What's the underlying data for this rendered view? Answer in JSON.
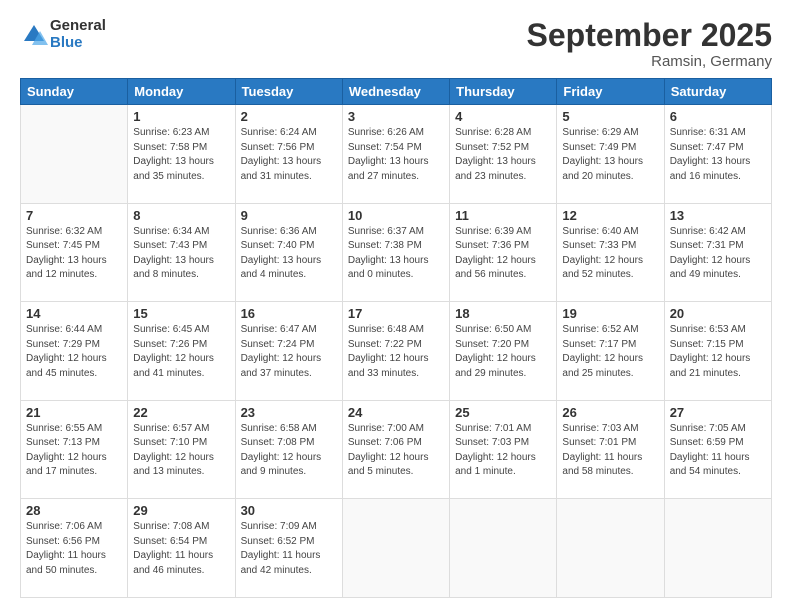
{
  "header": {
    "logo_line1": "General",
    "logo_line2": "Blue",
    "title": "September 2025",
    "subtitle": "Ramsin, Germany"
  },
  "days_of_week": [
    "Sunday",
    "Monday",
    "Tuesday",
    "Wednesday",
    "Thursday",
    "Friday",
    "Saturday"
  ],
  "weeks": [
    [
      {
        "day": "",
        "info": ""
      },
      {
        "day": "1",
        "info": "Sunrise: 6:23 AM\nSunset: 7:58 PM\nDaylight: 13 hours\nand 35 minutes."
      },
      {
        "day": "2",
        "info": "Sunrise: 6:24 AM\nSunset: 7:56 PM\nDaylight: 13 hours\nand 31 minutes."
      },
      {
        "day": "3",
        "info": "Sunrise: 6:26 AM\nSunset: 7:54 PM\nDaylight: 13 hours\nand 27 minutes."
      },
      {
        "day": "4",
        "info": "Sunrise: 6:28 AM\nSunset: 7:52 PM\nDaylight: 13 hours\nand 23 minutes."
      },
      {
        "day": "5",
        "info": "Sunrise: 6:29 AM\nSunset: 7:49 PM\nDaylight: 13 hours\nand 20 minutes."
      },
      {
        "day": "6",
        "info": "Sunrise: 6:31 AM\nSunset: 7:47 PM\nDaylight: 13 hours\nand 16 minutes."
      }
    ],
    [
      {
        "day": "7",
        "info": "Sunrise: 6:32 AM\nSunset: 7:45 PM\nDaylight: 13 hours\nand 12 minutes."
      },
      {
        "day": "8",
        "info": "Sunrise: 6:34 AM\nSunset: 7:43 PM\nDaylight: 13 hours\nand 8 minutes."
      },
      {
        "day": "9",
        "info": "Sunrise: 6:36 AM\nSunset: 7:40 PM\nDaylight: 13 hours\nand 4 minutes."
      },
      {
        "day": "10",
        "info": "Sunrise: 6:37 AM\nSunset: 7:38 PM\nDaylight: 13 hours\nand 0 minutes."
      },
      {
        "day": "11",
        "info": "Sunrise: 6:39 AM\nSunset: 7:36 PM\nDaylight: 12 hours\nand 56 minutes."
      },
      {
        "day": "12",
        "info": "Sunrise: 6:40 AM\nSunset: 7:33 PM\nDaylight: 12 hours\nand 52 minutes."
      },
      {
        "day": "13",
        "info": "Sunrise: 6:42 AM\nSunset: 7:31 PM\nDaylight: 12 hours\nand 49 minutes."
      }
    ],
    [
      {
        "day": "14",
        "info": "Sunrise: 6:44 AM\nSunset: 7:29 PM\nDaylight: 12 hours\nand 45 minutes."
      },
      {
        "day": "15",
        "info": "Sunrise: 6:45 AM\nSunset: 7:26 PM\nDaylight: 12 hours\nand 41 minutes."
      },
      {
        "day": "16",
        "info": "Sunrise: 6:47 AM\nSunset: 7:24 PM\nDaylight: 12 hours\nand 37 minutes."
      },
      {
        "day": "17",
        "info": "Sunrise: 6:48 AM\nSunset: 7:22 PM\nDaylight: 12 hours\nand 33 minutes."
      },
      {
        "day": "18",
        "info": "Sunrise: 6:50 AM\nSunset: 7:20 PM\nDaylight: 12 hours\nand 29 minutes."
      },
      {
        "day": "19",
        "info": "Sunrise: 6:52 AM\nSunset: 7:17 PM\nDaylight: 12 hours\nand 25 minutes."
      },
      {
        "day": "20",
        "info": "Sunrise: 6:53 AM\nSunset: 7:15 PM\nDaylight: 12 hours\nand 21 minutes."
      }
    ],
    [
      {
        "day": "21",
        "info": "Sunrise: 6:55 AM\nSunset: 7:13 PM\nDaylight: 12 hours\nand 17 minutes."
      },
      {
        "day": "22",
        "info": "Sunrise: 6:57 AM\nSunset: 7:10 PM\nDaylight: 12 hours\nand 13 minutes."
      },
      {
        "day": "23",
        "info": "Sunrise: 6:58 AM\nSunset: 7:08 PM\nDaylight: 12 hours\nand 9 minutes."
      },
      {
        "day": "24",
        "info": "Sunrise: 7:00 AM\nSunset: 7:06 PM\nDaylight: 12 hours\nand 5 minutes."
      },
      {
        "day": "25",
        "info": "Sunrise: 7:01 AM\nSunset: 7:03 PM\nDaylight: 12 hours\nand 1 minute."
      },
      {
        "day": "26",
        "info": "Sunrise: 7:03 AM\nSunset: 7:01 PM\nDaylight: 11 hours\nand 58 minutes."
      },
      {
        "day": "27",
        "info": "Sunrise: 7:05 AM\nSunset: 6:59 PM\nDaylight: 11 hours\nand 54 minutes."
      }
    ],
    [
      {
        "day": "28",
        "info": "Sunrise: 7:06 AM\nSunset: 6:56 PM\nDaylight: 11 hours\nand 50 minutes."
      },
      {
        "day": "29",
        "info": "Sunrise: 7:08 AM\nSunset: 6:54 PM\nDaylight: 11 hours\nand 46 minutes."
      },
      {
        "day": "30",
        "info": "Sunrise: 7:09 AM\nSunset: 6:52 PM\nDaylight: 11 hours\nand 42 minutes."
      },
      {
        "day": "",
        "info": ""
      },
      {
        "day": "",
        "info": ""
      },
      {
        "day": "",
        "info": ""
      },
      {
        "day": "",
        "info": ""
      }
    ]
  ]
}
